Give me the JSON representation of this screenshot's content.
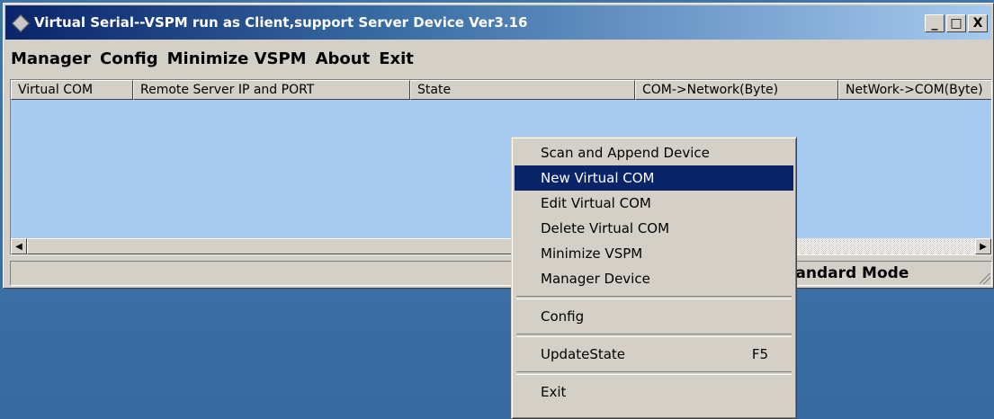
{
  "window": {
    "title": "Virtual Serial--VSPM run as Client,support Server Device  Ver3.16",
    "buttons": {
      "minimize": "_",
      "maximize": "□",
      "close": "X"
    }
  },
  "menubar": {
    "items": [
      "Manager",
      "Config",
      "Minimize VSPM",
      "About",
      "Exit"
    ]
  },
  "listview": {
    "columns": [
      "Virtual COM",
      "Remote Server IP and PORT",
      "State",
      "COM->Network(Byte)",
      "NetWork->COM(Byte)"
    ],
    "rows": []
  },
  "statusbar": {
    "left": "",
    "mode": "Standard Mode"
  },
  "context_menu": {
    "items": [
      {
        "label": "Scan and Append Device",
        "shortcut": "",
        "selected": false
      },
      {
        "label": "New Virtual COM",
        "shortcut": "",
        "selected": true
      },
      {
        "label": "Edit Virtual COM",
        "shortcut": "",
        "selected": false
      },
      {
        "label": "Delete Virtual COM",
        "shortcut": "",
        "selected": false
      },
      {
        "label": "Minimize VSPM",
        "shortcut": "",
        "selected": false
      },
      {
        "label": "Manager Device",
        "shortcut": "",
        "selected": false
      },
      {
        "label": "Config",
        "shortcut": "",
        "selected": false
      },
      {
        "label": "UpdateState",
        "shortcut": "F5",
        "selected": false
      },
      {
        "label": "Exit",
        "shortcut": "",
        "selected": false
      }
    ]
  },
  "colors": {
    "titlebar_start": "#0a246a",
    "titlebar_end": "#a6caf0",
    "list_background": "#a6caf0",
    "selection": "#0a246a",
    "desktop": "#3a6ea5"
  },
  "icons": {
    "app": "diamond-app-icon",
    "scroll_left": "arrow-left-icon",
    "scroll_right": "arrow-right-icon"
  }
}
